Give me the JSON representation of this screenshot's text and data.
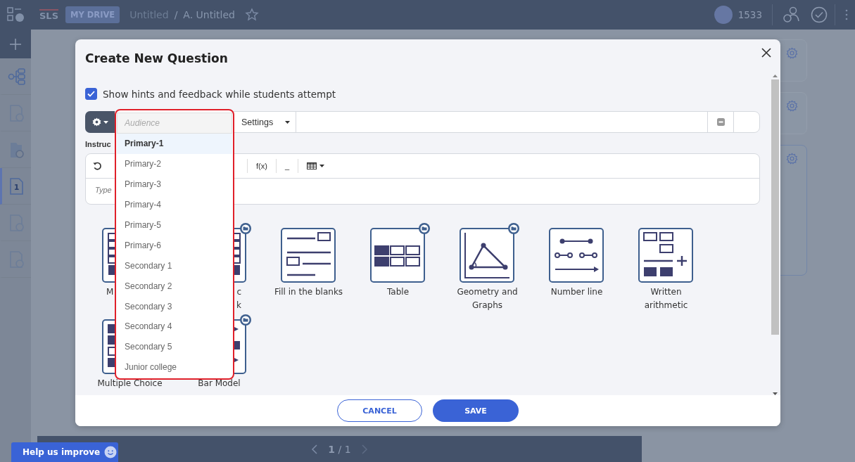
{
  "topbar": {
    "logo": "SLS",
    "drive_badge": "MY DRIVE",
    "breadcrumb": [
      "Untitled",
      "A. Untitled"
    ],
    "separator": "/",
    "points": "1533"
  },
  "sidebar": {
    "items": [
      {
        "kind": "tree",
        "selected": false
      },
      {
        "kind": "doc",
        "selected": false
      },
      {
        "kind": "folder",
        "selected": false
      },
      {
        "kind": "page",
        "label": "1",
        "selected": true
      },
      {
        "kind": "doc",
        "selected": false
      },
      {
        "kind": "doc",
        "selected": false
      }
    ]
  },
  "pager": {
    "current": "1",
    "separator": "/",
    "total": "1"
  },
  "help_button": "Help us improve",
  "modal": {
    "title": "Create New Question",
    "hints": {
      "label": "Show hints and feedback while students attempt",
      "checked": true
    },
    "settings_label": "Settings",
    "instructions_label": "Instruc",
    "editor": {
      "formula_button": "f(x)",
      "blank_button": "_",
      "placeholder": "Type"
    },
    "question_types": [
      {
        "kind": "stack",
        "lines": [
          "M"
        ]
      },
      {
        "kind": "stack",
        "lines": [
          "c",
          "k"
        ],
        "folder": true
      },
      {
        "kind": "fill-blanks",
        "lines": [
          "Fill in the blanks"
        ],
        "folder": false
      },
      {
        "kind": "table",
        "lines": [
          "Table"
        ],
        "folder": true
      },
      {
        "kind": "geometry",
        "lines": [
          "Geometry and",
          "Graphs"
        ],
        "folder": true
      },
      {
        "kind": "number-line",
        "lines": [
          "Number line"
        ],
        "folder": false
      },
      {
        "kind": "written-arithmetic",
        "lines": [
          "Written",
          "arithmetic"
        ],
        "folder": false
      },
      {
        "kind": "multiple-choice",
        "lines": [
          "Multiple Choice"
        ]
      },
      {
        "kind": "bar-model",
        "lines": [
          "Bar Model"
        ],
        "folder": true
      }
    ],
    "audience_dropdown": {
      "placeholder": "Audience",
      "options": [
        {
          "label": "Primary-1",
          "selected": true
        },
        {
          "label": "Primary-2",
          "selected": false
        },
        {
          "label": "Primary-3",
          "selected": false
        },
        {
          "label": "Primary-4",
          "selected": false
        },
        {
          "label": "Primary-5",
          "selected": false
        },
        {
          "label": "Primary-6",
          "selected": false
        },
        {
          "label": "Secondary 1",
          "selected": false
        },
        {
          "label": "Secondary 2",
          "selected": false
        },
        {
          "label": "Secondary 3",
          "selected": false
        },
        {
          "label": "Secondary 4",
          "selected": false
        },
        {
          "label": "Secondary 5",
          "selected": false
        },
        {
          "label": "Junior college",
          "selected": false
        }
      ]
    },
    "buttons": {
      "cancel": "CANCEL",
      "save": "SAVE"
    }
  }
}
